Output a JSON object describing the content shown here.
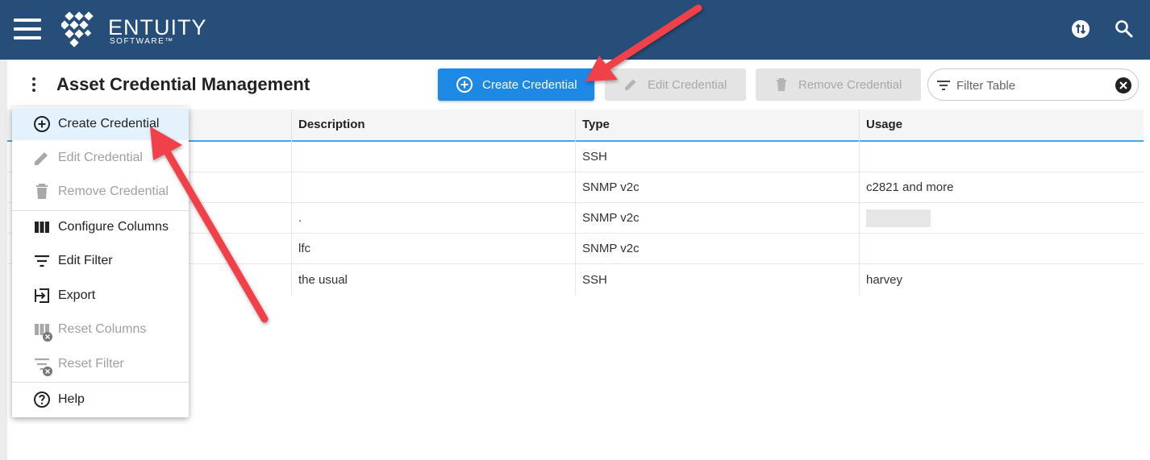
{
  "brand": {
    "name": "ENTUITY",
    "tagline": "SOFTWARE™"
  },
  "header": {
    "title": "Asset Credential Management"
  },
  "toolbar": {
    "create_label": "Create Credential",
    "edit_label": "Edit Credential",
    "remove_label": "Remove Credential",
    "filter_placeholder": "Filter Table"
  },
  "table": {
    "columns": [
      "Description",
      "Type",
      "Usage"
    ],
    "rows": [
      {
        "description": "",
        "type": "SSH",
        "usage": ""
      },
      {
        "description": "",
        "type": "SNMP v2c",
        "usage": "c2821 and more"
      },
      {
        "description": ".",
        "type": "SNMP v2c",
        "usage": ""
      },
      {
        "description": "lfc",
        "type": "SNMP v2c",
        "usage": ""
      },
      {
        "description": "the usual",
        "type": "SSH",
        "usage": "harvey"
      }
    ]
  },
  "menu": {
    "items": [
      {
        "label": "Create Credential",
        "icon": "add-circle-icon"
      },
      {
        "label": "Edit Credential",
        "icon": "pencil-icon"
      },
      {
        "label": "Remove Credential",
        "icon": "trash-icon"
      },
      {
        "label": "Configure Columns",
        "icon": "columns-icon"
      },
      {
        "label": "Edit Filter",
        "icon": "filter-icon"
      },
      {
        "label": "Export",
        "icon": "export-icon"
      },
      {
        "label": "Reset Columns",
        "icon": "reset-columns-icon"
      },
      {
        "label": "Reset Filter",
        "icon": "reset-filter-icon"
      },
      {
        "label": "Help",
        "icon": "help-icon"
      }
    ]
  },
  "colors": {
    "topbar": "#264e78",
    "primary": "#1e88e5",
    "annotation_arrow": "#f0414a",
    "menu_highlight": "#e3f2fd"
  }
}
